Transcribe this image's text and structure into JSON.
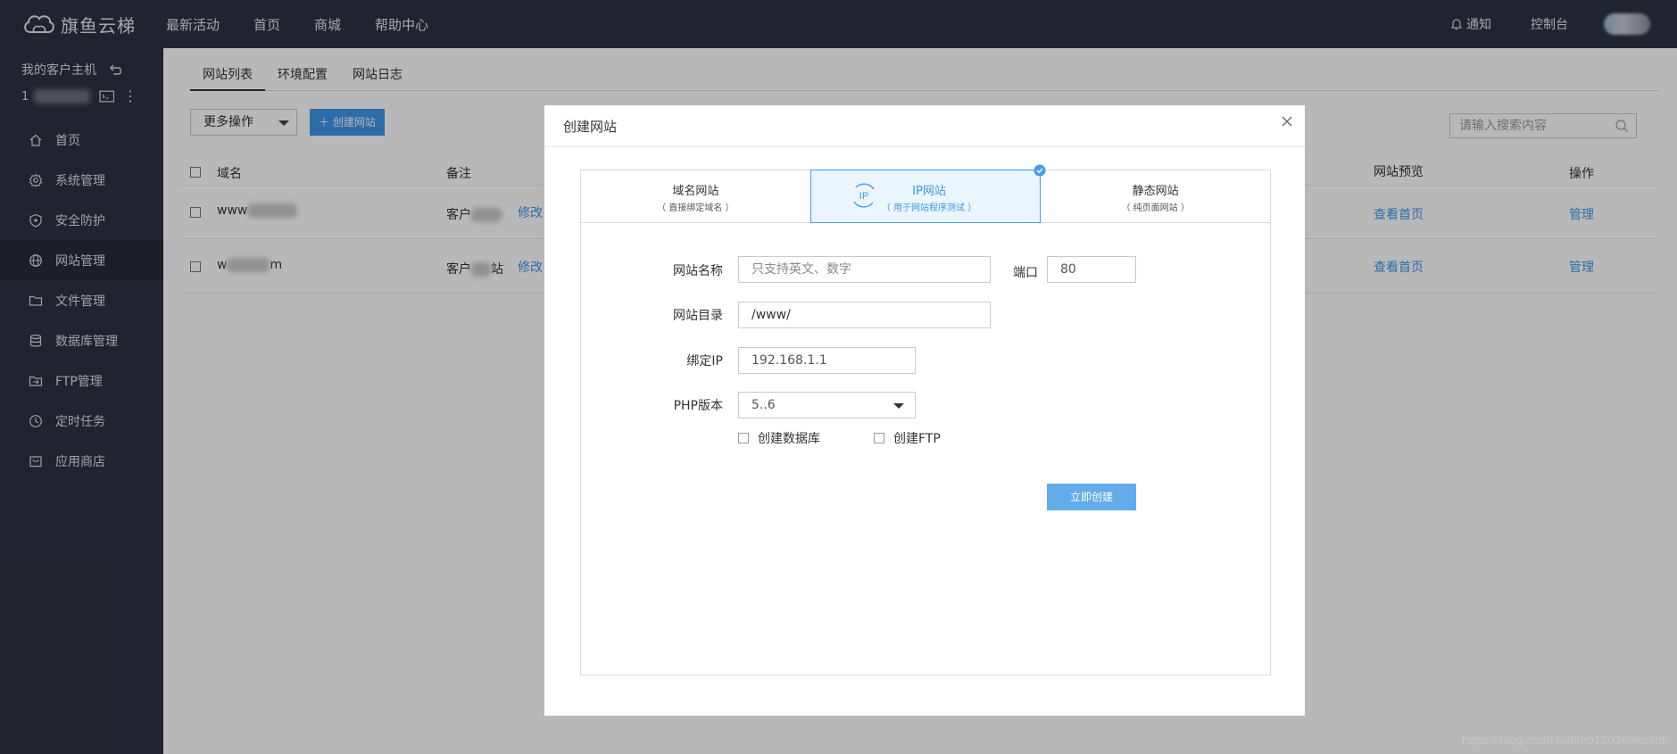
{
  "brand": {
    "name": "旗鱼云梯"
  },
  "topnav": {
    "items": [
      "最新活动",
      "首页",
      "商城",
      "帮助中心"
    ]
  },
  "topright": {
    "notice": "通知",
    "console": "控制台"
  },
  "sidebar": {
    "host_title": "我的客户主机",
    "host_number": "1",
    "items": [
      {
        "label": "首页",
        "icon": "home-icon"
      },
      {
        "label": "系统管理",
        "icon": "gear-icon"
      },
      {
        "label": "安全防护",
        "icon": "shield-icon"
      },
      {
        "label": "网站管理",
        "icon": "globe-icon",
        "active": true
      },
      {
        "label": "文件管理",
        "icon": "folder-icon"
      },
      {
        "label": "数据库管理",
        "icon": "database-icon"
      },
      {
        "label": "FTP管理",
        "icon": "ftp-icon"
      },
      {
        "label": "定时任务",
        "icon": "clock-icon"
      },
      {
        "label": "应用商店",
        "icon": "store-icon"
      }
    ]
  },
  "tabs": [
    "网站列表",
    "环境配置",
    "网站日志"
  ],
  "toolbar": {
    "more_label": "更多操作",
    "create_label": "＋ 创建网站",
    "search_placeholder": "请输入搜索内容"
  },
  "table": {
    "headers": {
      "domain": "域名",
      "remark": "备注",
      "preview": "网站预览",
      "action": "操作"
    },
    "rows": [
      {
        "domain": "www",
        "remark": "客户",
        "modify": "修改",
        "preview": "查看首页",
        "action": "管理"
      },
      {
        "domain": "w",
        "domain_tail": "m",
        "remark": "客户",
        "remark_tail": "站",
        "modify": "修改",
        "preview": "查看首页",
        "action": "管理"
      }
    ]
  },
  "modal": {
    "title": "创建网站",
    "types": [
      {
        "label": "域名网站",
        "sub": "（ 直接绑定域名 ）"
      },
      {
        "label": "IP网站",
        "sub": "（ 用于网站程序测试 ）",
        "icon_text": "IP",
        "active": true
      },
      {
        "label": "静态网站",
        "sub": "（ 纯页面网站 ）"
      }
    ],
    "form": {
      "name_label": "网站名称",
      "name_placeholder": "只支持英文、数字",
      "port_label": "端口",
      "port_value": "80",
      "dir_label": "网站目录",
      "dir_value": "/www/",
      "ip_label": "绑定IP",
      "ip_value": "192.168.1.1",
      "php_label": "PHP版本",
      "php_value": "5..6",
      "db_checkbox": "创建数据库",
      "ftp_checkbox": "创建FTP",
      "submit": "立即创建"
    }
  },
  "watermark": "https://blog.csdn.net/leo12036okokok",
  "colors": {
    "accent": "#3d96e8",
    "sidebar_bg": "#2c3340"
  }
}
